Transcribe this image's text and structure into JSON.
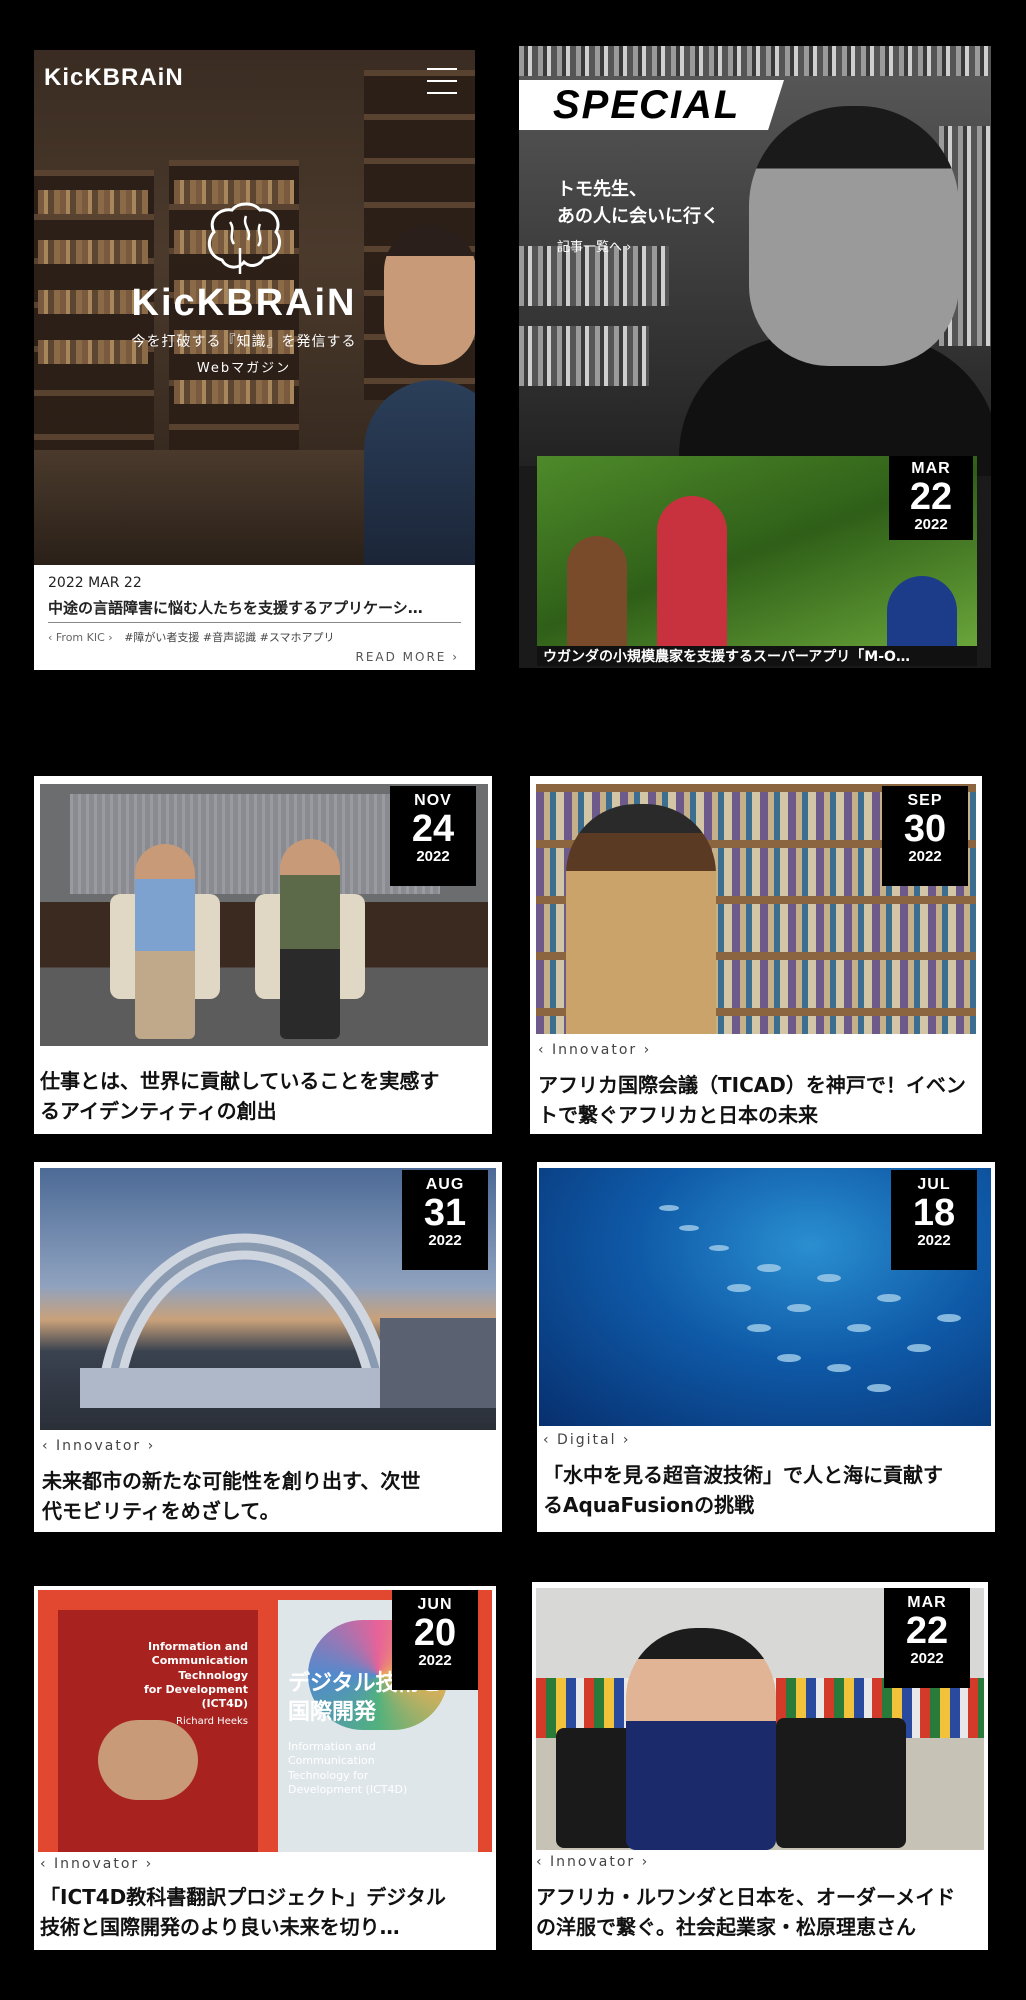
{
  "hero": {
    "logo": "KicKBRAiN",
    "brand": "KicKBRAiN",
    "tagline": "今を打破する『知識』を発信する",
    "subtitle": "Webマガジン",
    "date": "2022 MAR 22",
    "title": "中途の言語障害に悩む人たちを支援するアプリケーシ…",
    "category": "‹ From KIC ›",
    "tags": "#障がい者支援 #音声認識 #スマホアプリ",
    "read_more": "READ MORE ›"
  },
  "special": {
    "banner": "SPECIAL",
    "line1": "トモ先生、",
    "line2": "あの人に会いに行く",
    "line3": "記事一覧へ ›",
    "badge": {
      "month": "MAR",
      "day": "22",
      "year": "2022"
    },
    "caption": "ウガンダの小規模農家を支援するスーパーアプリ「M-O…"
  },
  "articles": [
    {
      "month": "NOV",
      "day": "24",
      "year": "2022",
      "category": "",
      "title_l1": "仕事とは、世界に貢献していることを実感す",
      "title_l2": "るアイデンティティの創出"
    },
    {
      "month": "SEP",
      "day": "30",
      "year": "2022",
      "category": "‹ Innovator ›",
      "title_l1": "アフリカ国際会議（TICAD）を神戸で！イベン",
      "title_l2": "トで繋ぐアフリカと日本の未来"
    },
    {
      "month": "AUG",
      "day": "31",
      "year": "2022",
      "category": "‹ Innovator ›",
      "title_l1": "未来都市の新たな可能性を創り出す、次世",
      "title_l2": "代モビリティをめざして。"
    },
    {
      "month": "JUL",
      "day": "18",
      "year": "2022",
      "category": "‹ Digital ›",
      "title_l1": "「水中を見る超音波技術」で人と海に貢献す",
      "title_l2": "るAquaFusionの挑戦"
    },
    {
      "month": "JUN",
      "day": "20",
      "year": "2022",
      "category": "‹ Innovator ›",
      "title_l1": "「ICT4D教科書翻訳プロジェクト」デジタル",
      "title_l2": "技術と国際開発のより良い未来を切り…"
    },
    {
      "month": "MAR",
      "day": "22",
      "year": "2022",
      "category": "‹ Innovator ›",
      "title_l1": "アフリカ・ルワンダと日本を、オーダーメイド",
      "title_l2": "の洋服で繋ぐ。社会起業家・松原理恵さん"
    }
  ],
  "book_covers": {
    "left_l1": "Information and",
    "left_l2": "Communication Technology",
    "left_l3": "for Development (ICT4D)",
    "left_author": "Richard Heeks",
    "right_title_l1": "デジタル技術と",
    "right_title_l2": "国際開発",
    "right_en_l1": "Information and",
    "right_en_l2": "Communication",
    "right_en_l3": "Technology for",
    "right_en_l4": "Development (ICT4D)"
  },
  "colors": {
    "background": "#000000",
    "card": "#ffffff",
    "badge": "#000000"
  }
}
